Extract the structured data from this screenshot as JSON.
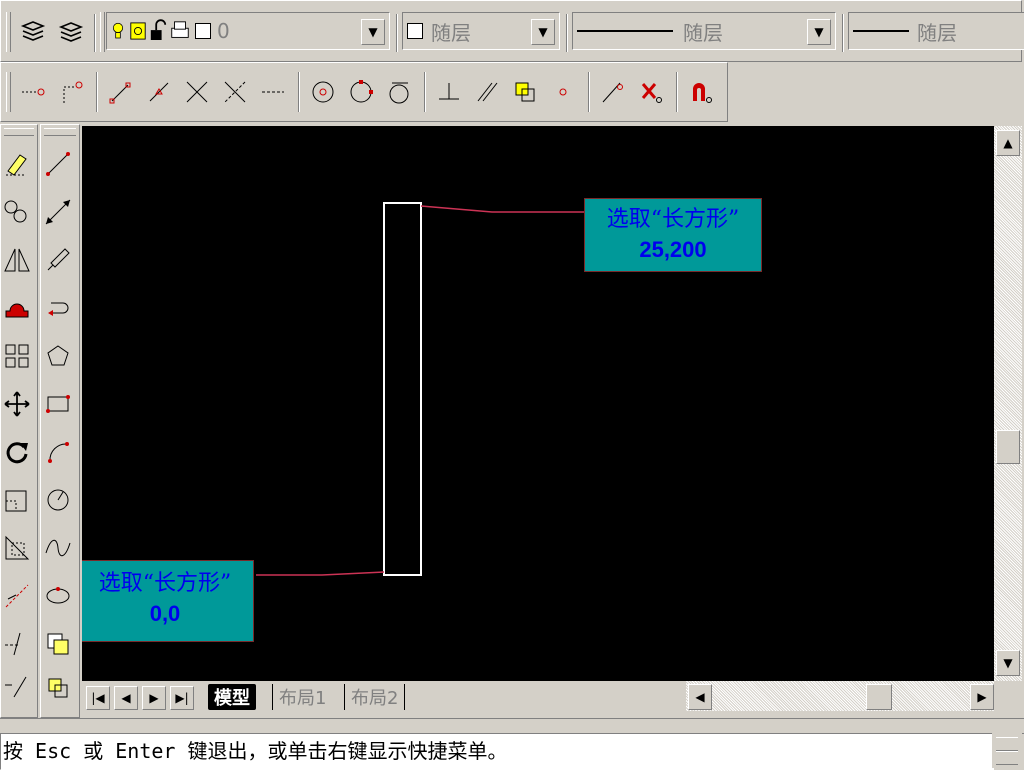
{
  "layers_toolbar": {
    "layer_value": "0",
    "color_value": "随层",
    "linetype_value": "随层",
    "lineweight_value": "随层"
  },
  "snap_toolbar": {
    "icons": [
      "snap-extension-icon",
      "snap-from-icon",
      "snap-endpoint-icon",
      "snap-midpoint-icon",
      "snap-intersection-icon",
      "snap-apparent-intersection-icon",
      "snap-extension-line-icon",
      "snap-center-icon",
      "snap-quadrant-icon",
      "snap-tangent-icon",
      "snap-perpendicular-icon",
      "snap-parallel-icon",
      "snap-insert-icon",
      "snap-node-icon",
      "snap-nearest-icon",
      "snap-none-icon",
      "snap-settings-icon"
    ]
  },
  "drawing": {
    "callout_top": {
      "line1": "选取“长方形”",
      "line2": "25,200"
    },
    "callout_bottom": {
      "line1": "选取“长方形”",
      "line2": "0,0"
    }
  },
  "tabs": {
    "model": "模型",
    "layout1": "布局1",
    "layout2": "布局2"
  },
  "command_line": {
    "prompt": "按 Esc 或 Enter 键退出，或单击右键显示快捷菜单。"
  },
  "colors": {
    "canvas": "#000000",
    "callout_fill": "#009999",
    "callout_text": "#0000ee",
    "leader": "#cc3355"
  }
}
